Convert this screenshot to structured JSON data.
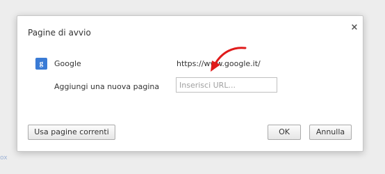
{
  "dialog": {
    "title": "Pagine di avvio",
    "close_icon": "close-icon",
    "close_glyph": "×"
  },
  "startup_pages": [
    {
      "icon": "google-icon",
      "icon_glyph": "g",
      "name": "Google",
      "url": "https://www.google.it/"
    }
  ],
  "add_page": {
    "label": "Aggiungi una nuova pagina",
    "placeholder": "Inserisci URL..."
  },
  "buttons": {
    "use_current": "Usa pagine correnti",
    "ok": "OK",
    "cancel": "Annulla"
  },
  "annotation": {
    "icon": "red-arrow-icon",
    "color": "#e01b1b"
  },
  "background": {
    "link_fragment": "ox"
  },
  "colors": {
    "google_icon_bg": "#3a7bd5"
  }
}
